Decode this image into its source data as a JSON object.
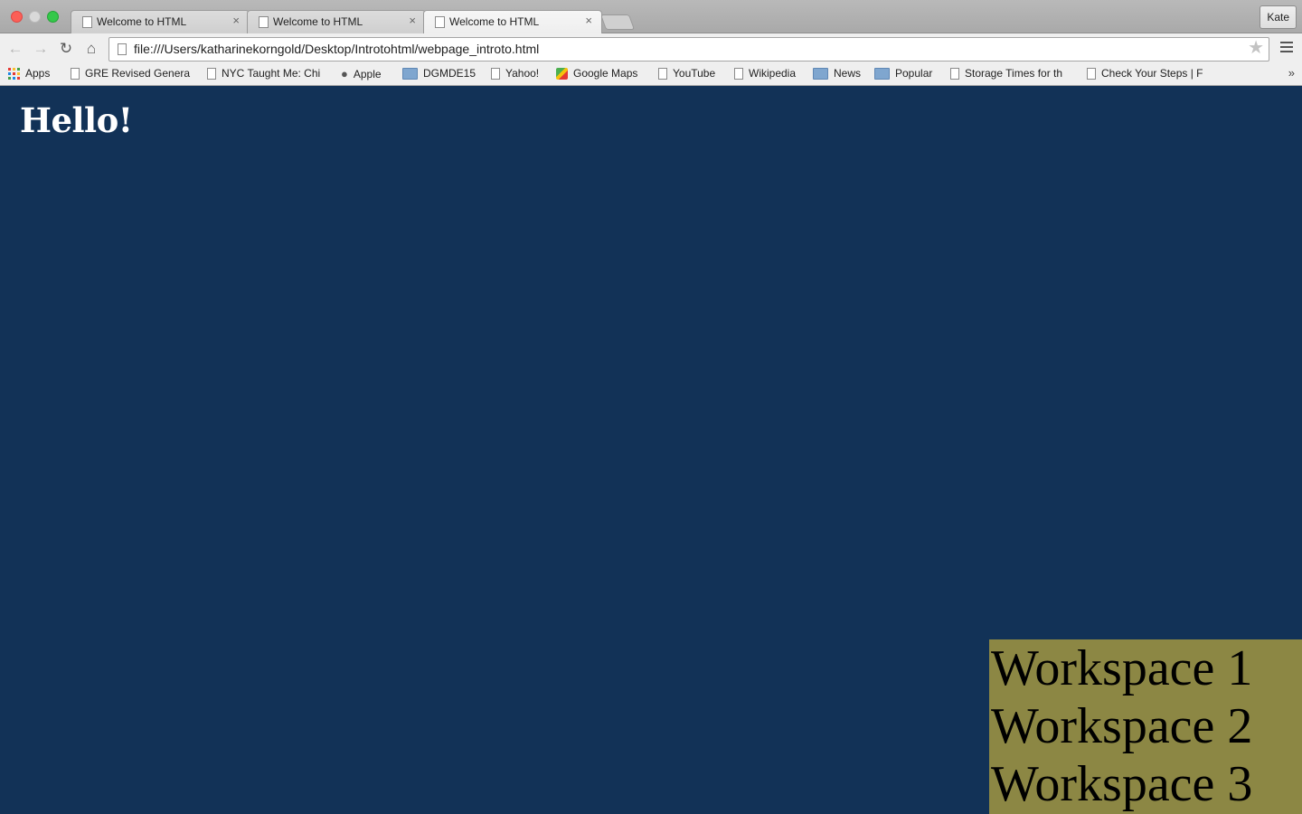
{
  "browser": {
    "tabs": [
      {
        "title": "Welcome to HTML"
      },
      {
        "title": "Welcome to HTML"
      },
      {
        "title": "Welcome to HTML"
      }
    ],
    "profile_name": "Kate",
    "url": "file:///Users/katharinekorngold/Desktop/Introtohtml/webpage_introto.html",
    "bookmarks": [
      {
        "label": "Apps",
        "icon": "apps-icon"
      },
      {
        "label": "GRE Revised Genera",
        "icon": "page-icon"
      },
      {
        "label": "NYC Taught Me: Chi",
        "icon": "page-icon"
      },
      {
        "label": "Apple",
        "icon": "apple-icon"
      },
      {
        "label": "DGMDE15",
        "icon": "folder-icon"
      },
      {
        "label": "Yahoo!",
        "icon": "page-icon"
      },
      {
        "label": "Google Maps",
        "icon": "maps-icon"
      },
      {
        "label": "YouTube",
        "icon": "page-icon"
      },
      {
        "label": "Wikipedia",
        "icon": "page-icon"
      },
      {
        "label": "News",
        "icon": "folder-icon"
      },
      {
        "label": "Popular",
        "icon": "folder-icon"
      },
      {
        "label": "Storage Times for th",
        "icon": "page-icon"
      },
      {
        "label": "Check Your Steps | F",
        "icon": "page-icon"
      }
    ],
    "overflow_label": "»"
  },
  "page": {
    "heading": "Hello!",
    "background_color": "#123257",
    "workspace_box_color": "#8c8744",
    "workspaces": [
      "Workspace 1",
      "Workspace 2",
      "Workspace 3"
    ]
  }
}
